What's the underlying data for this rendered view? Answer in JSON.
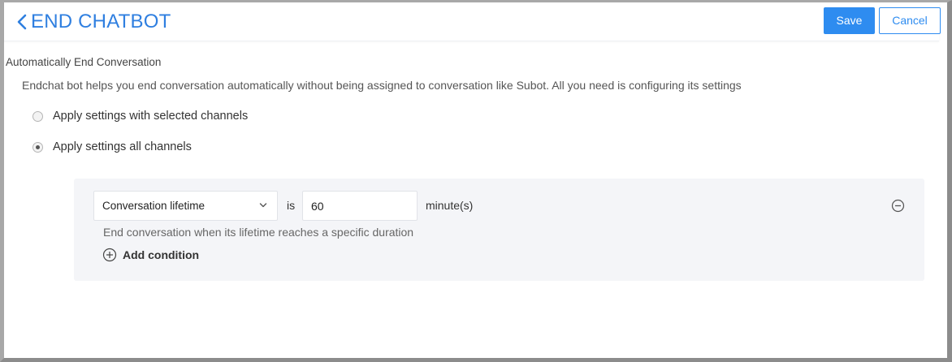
{
  "header": {
    "title": "END CHATBOT",
    "save_label": "Save",
    "cancel_label": "Cancel",
    "back_icon": "chevron-left-icon"
  },
  "section": {
    "title": "Automatically End Conversation",
    "description": "Endchat bot helps you end conversation automatically without being assigned to conversation like Subot. All you need is configuring its settings"
  },
  "options": [
    {
      "label": "Apply settings with selected channels",
      "checked": false
    },
    {
      "label": "Apply settings all channels",
      "checked": true
    }
  ],
  "condition": {
    "field_selected": "Conversation lifetime",
    "operator": "is",
    "value": "60",
    "unit": "minute(s)",
    "help": "End conversation when its lifetime reaches a specific duration",
    "remove_icon": "minus-circle-icon"
  },
  "add_condition": {
    "label": "Add condition",
    "icon": "plus-circle-icon"
  },
  "colors": {
    "accent": "#2e8cf0",
    "title": "#2f7fe0",
    "panel_bg": "#f4f5f8"
  }
}
